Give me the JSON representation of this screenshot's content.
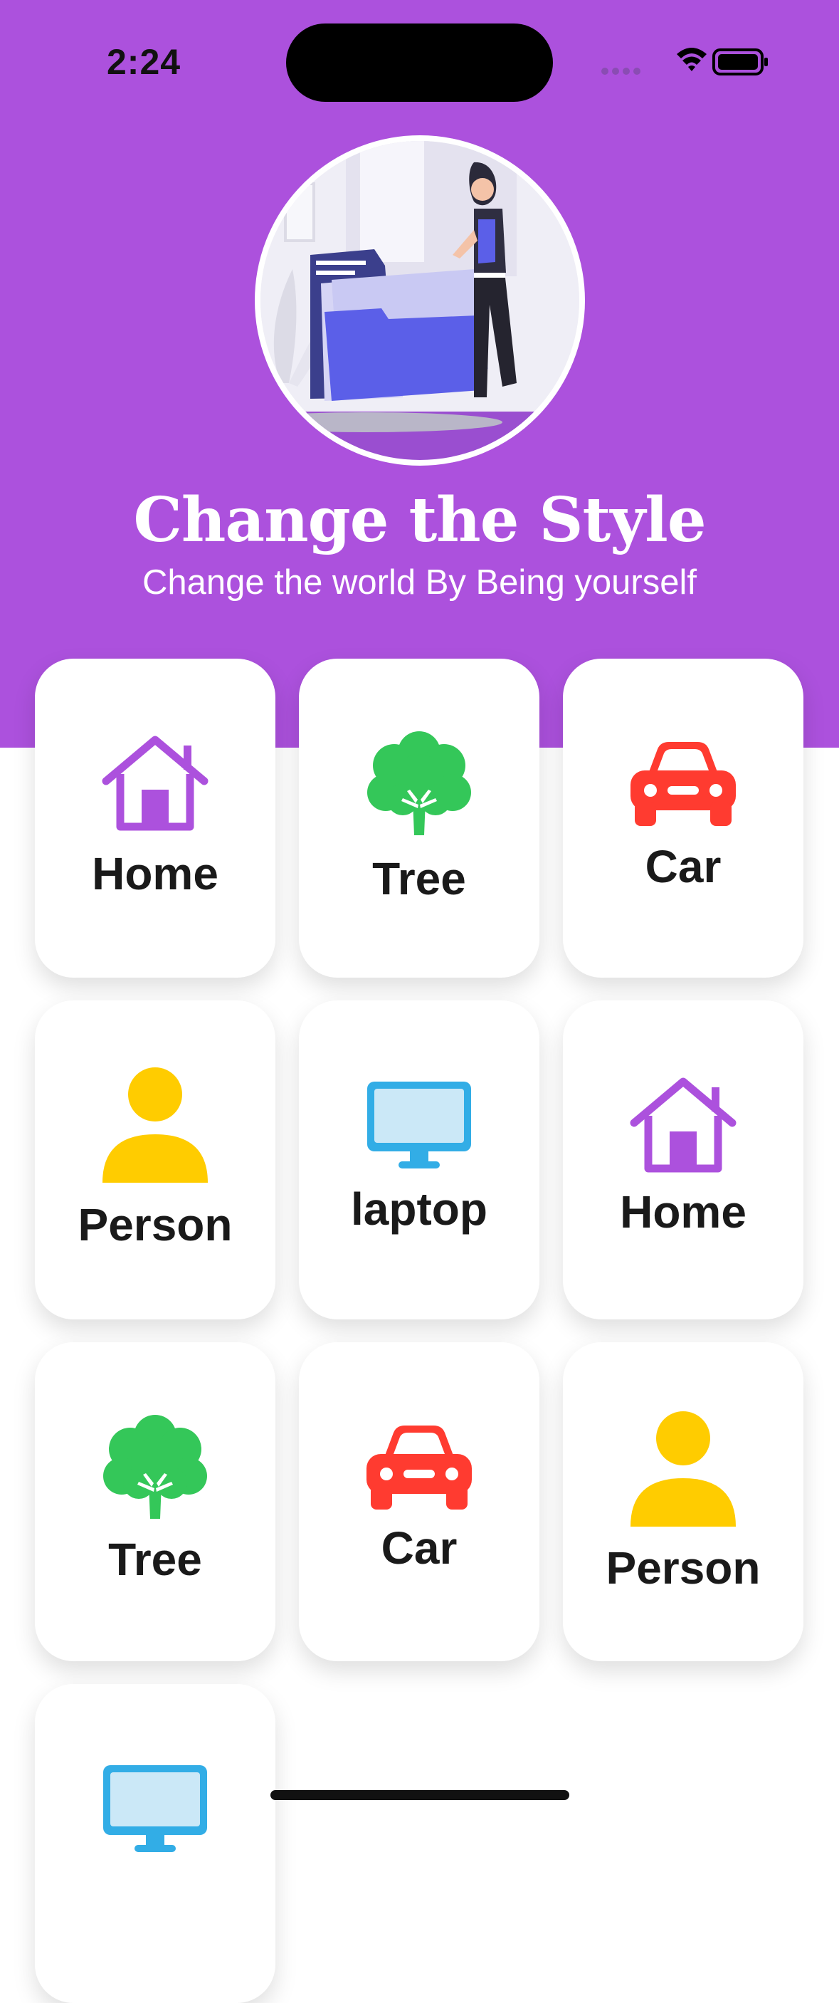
{
  "status_bar": {
    "time": "2:24"
  },
  "header": {
    "title": "Change the Style",
    "subtitle": "Change the world By Being yourself",
    "background_color": "#ac51dd"
  },
  "grid": {
    "items": [
      {
        "label": "Home",
        "icon": "house-icon",
        "color": "#ac51dd"
      },
      {
        "label": "Tree",
        "icon": "tree-icon",
        "color": "#34c759"
      },
      {
        "label": "Car",
        "icon": "car-icon",
        "color": "#ff3b30"
      },
      {
        "label": "Person",
        "icon": "person-icon",
        "color": "#ffcc00"
      },
      {
        "label": "laptop",
        "icon": "desktop-icon",
        "color": "#32ade6"
      },
      {
        "label": "Home",
        "icon": "house-icon",
        "color": "#ac51dd"
      },
      {
        "label": "Tree",
        "icon": "tree-icon",
        "color": "#34c759"
      },
      {
        "label": "Car",
        "icon": "car-icon",
        "color": "#ff3b30"
      },
      {
        "label": "Person",
        "icon": "person-icon",
        "color": "#ffcc00"
      },
      {
        "label": "",
        "icon": "desktop-icon",
        "color": "#32ade6"
      }
    ]
  }
}
